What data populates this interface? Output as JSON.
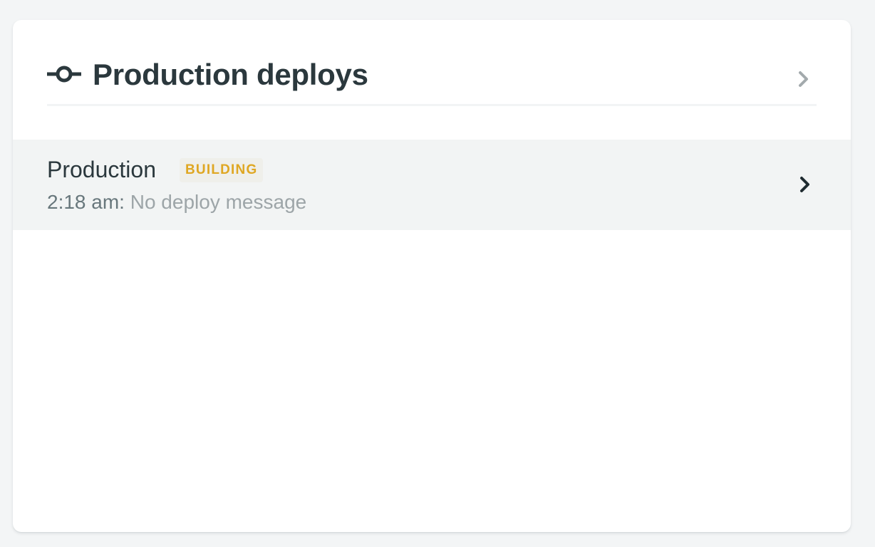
{
  "card": {
    "title": "Production deploys",
    "title_icon": "commit-icon",
    "header_chevron_icon": "chevron-right-icon"
  },
  "deploys": [
    {
      "name": "Production",
      "status": "BUILDING",
      "time": "2:18 am:",
      "message": "No deploy message",
      "chevron_icon": "chevron-right-icon"
    }
  ],
  "colors": {
    "background": "#f3f5f6",
    "text": "#2b383d",
    "building_badge_text": "#dfa722",
    "building_badge_bg": "#efefea",
    "row_background": "#f2f4f4"
  }
}
